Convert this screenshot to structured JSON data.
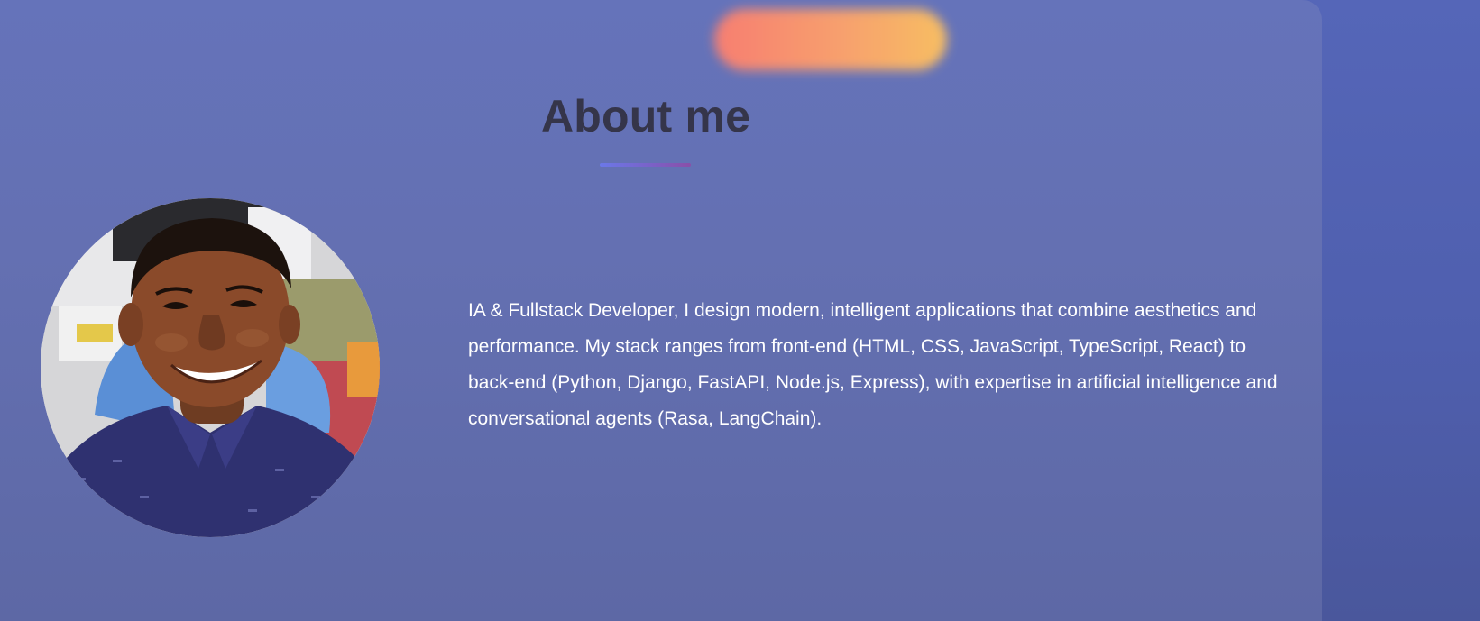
{
  "about": {
    "title": "About me",
    "bio": "IA & Fullstack Developer, I design modern, intelligent applications that combine aesthetics and performance. My stack ranges from front-end (HTML, CSS, JavaScript, TypeScript, React) to back-end (Python, Django, FastAPI, Node.js, Express), with expertise in artificial intelligence and conversational agents (Rasa, LangChain)."
  },
  "colors": {
    "page_background": "#5566b8",
    "card_background": "#6573ba",
    "title_text": "#35354a",
    "body_text": "#ffffff",
    "accent_gradient_start": "#ff7f6e",
    "accent_gradient_end": "#ffc25e",
    "underline_start": "#6b78e8",
    "underline_end": "#8a4fa8"
  }
}
